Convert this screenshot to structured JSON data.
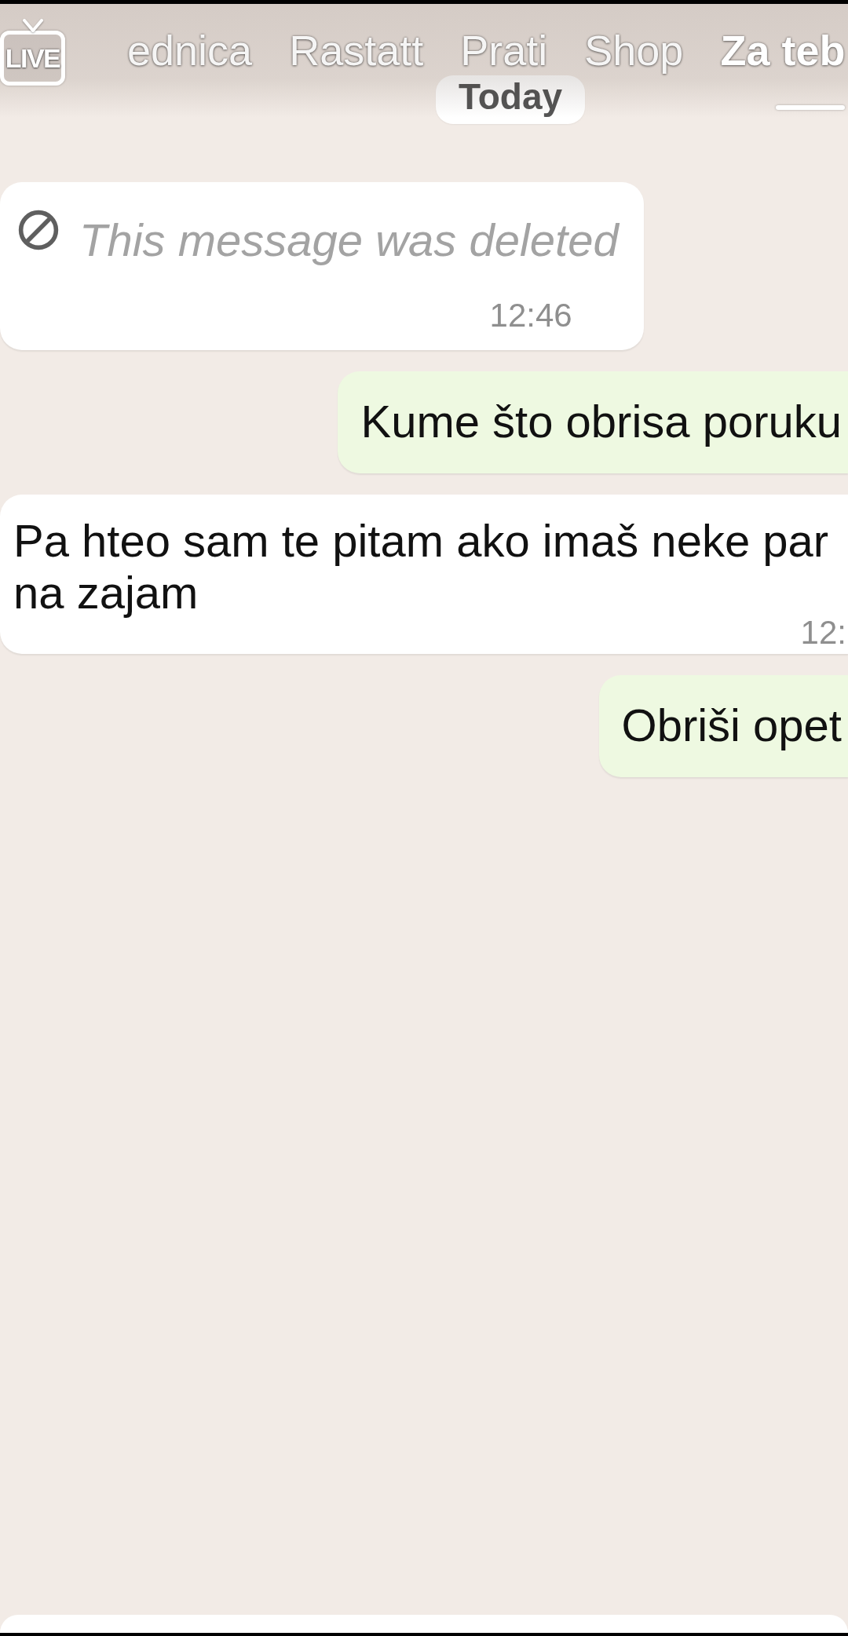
{
  "tab_bar": {
    "live_label": "LIVE",
    "tabs": [
      {
        "label": "ednica",
        "selected": false
      },
      {
        "label": "Rastatt",
        "selected": false
      },
      {
        "label": "Prati",
        "selected": false
      },
      {
        "label": "Shop",
        "selected": false
      },
      {
        "label": "Za teb",
        "selected": true
      }
    ]
  },
  "chat": {
    "date_chip": "Today",
    "messages": [
      {
        "outgoing": false,
        "kind": "deleted",
        "text": "This message was deleted",
        "time": "12:46"
      },
      {
        "outgoing": true,
        "kind": "text",
        "text": "Kume što obrisa poruku"
      },
      {
        "outgoing": false,
        "kind": "text",
        "text": "Pa hteo sam te pitam ako imaš neke par\nna zajam",
        "time": "12:"
      },
      {
        "outgoing": true,
        "kind": "text",
        "text": "Obriši opet"
      }
    ]
  }
}
